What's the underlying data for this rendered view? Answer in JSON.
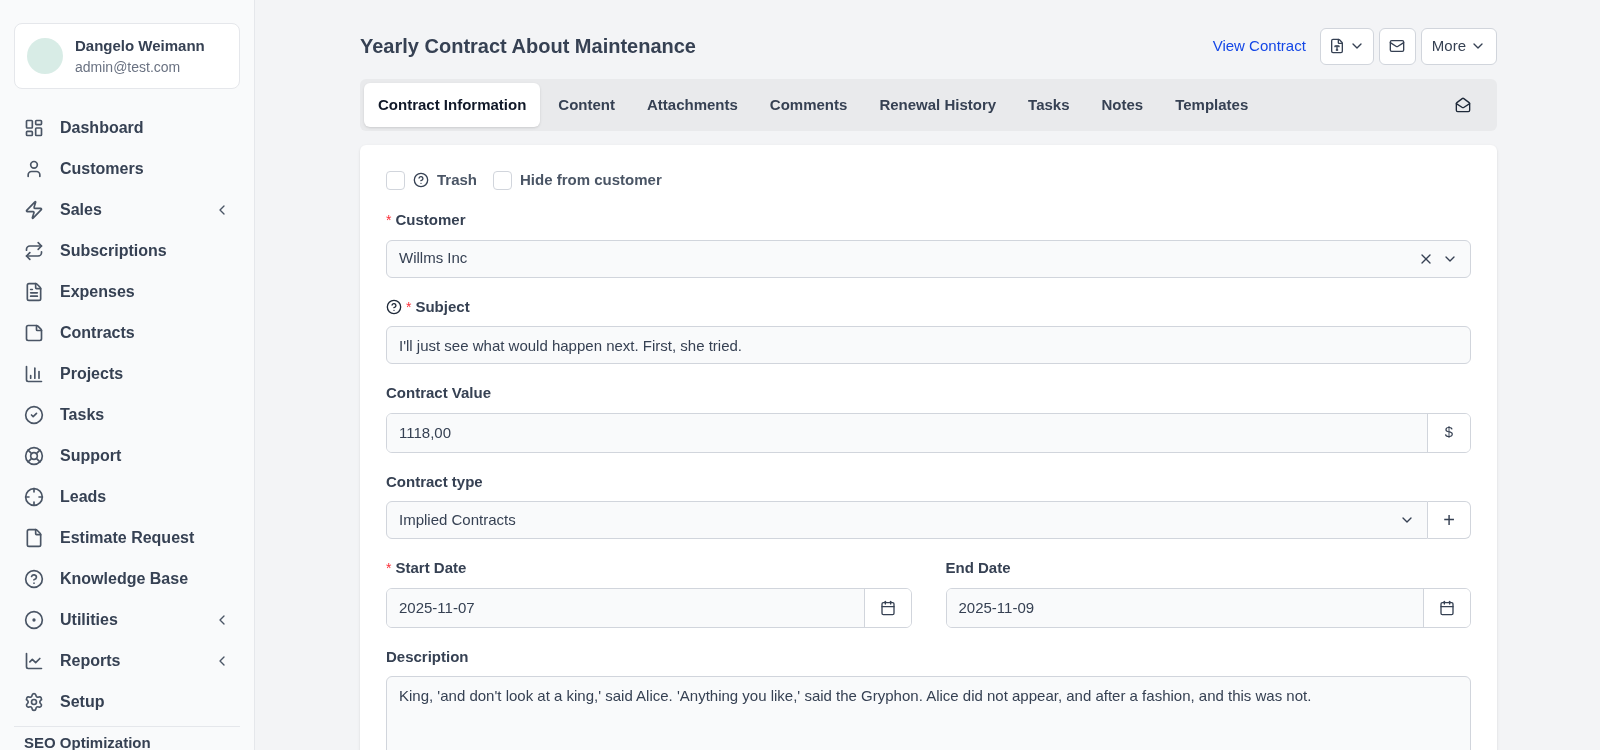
{
  "user": {
    "name": "Dangelo Weimann",
    "email": "admin@test.com"
  },
  "sidebar": {
    "items": [
      {
        "label": "Dashboard",
        "has_submenu": false
      },
      {
        "label": "Customers",
        "has_submenu": false
      },
      {
        "label": "Sales",
        "has_submenu": true
      },
      {
        "label": "Subscriptions",
        "has_submenu": false
      },
      {
        "label": "Expenses",
        "has_submenu": false
      },
      {
        "label": "Contracts",
        "has_submenu": false
      },
      {
        "label": "Projects",
        "has_submenu": false
      },
      {
        "label": "Tasks",
        "has_submenu": false
      },
      {
        "label": "Support",
        "has_submenu": false
      },
      {
        "label": "Leads",
        "has_submenu": false
      },
      {
        "label": "Estimate Request",
        "has_submenu": false
      },
      {
        "label": "Knowledge Base",
        "has_submenu": false
      },
      {
        "label": "Utilities",
        "has_submenu": true
      },
      {
        "label": "Reports",
        "has_submenu": true
      },
      {
        "label": "Setup",
        "has_submenu": false
      }
    ],
    "section_heading": "SEO Optimization"
  },
  "page": {
    "title": "Yearly Contract About Maintenance",
    "view_link": "View Contract",
    "more_button": "More"
  },
  "tabs": [
    {
      "label": "Contract Information",
      "selected": true
    },
    {
      "label": "Content",
      "selected": false
    },
    {
      "label": "Attachments",
      "selected": false
    },
    {
      "label": "Comments",
      "selected": false
    },
    {
      "label": "Renewal History",
      "selected": false
    },
    {
      "label": "Tasks",
      "selected": false
    },
    {
      "label": "Notes",
      "selected": false
    },
    {
      "label": "Templates",
      "selected": false
    }
  ],
  "form": {
    "checkboxes": [
      {
        "label": "Trash",
        "checked": false,
        "help": true
      },
      {
        "label": "Hide from customer",
        "checked": false,
        "help": false
      }
    ],
    "customer": {
      "label": "Customer",
      "required_mark": "*",
      "value": "Willms Inc"
    },
    "subject": {
      "label": "Subject",
      "required_mark": "*",
      "value": "I'll just see what would happen next. First, she tried."
    },
    "contract_value": {
      "label": "Contract Value",
      "value": "1118,00",
      "addon": "$"
    },
    "contract_type": {
      "label": "Contract type",
      "value": "Implied Contracts",
      "addon": "+"
    },
    "start_date": {
      "label": "Start Date",
      "required_mark": "*",
      "value": "2025-11-07"
    },
    "end_date": {
      "label": "End Date",
      "value": "2025-11-09"
    },
    "description": {
      "label": "Description",
      "value": "King, 'and don't look at a king,' said Alice. 'Anything you like,' said the Gryphon. Alice did not appear, and after a fashion, and this was not."
    }
  }
}
